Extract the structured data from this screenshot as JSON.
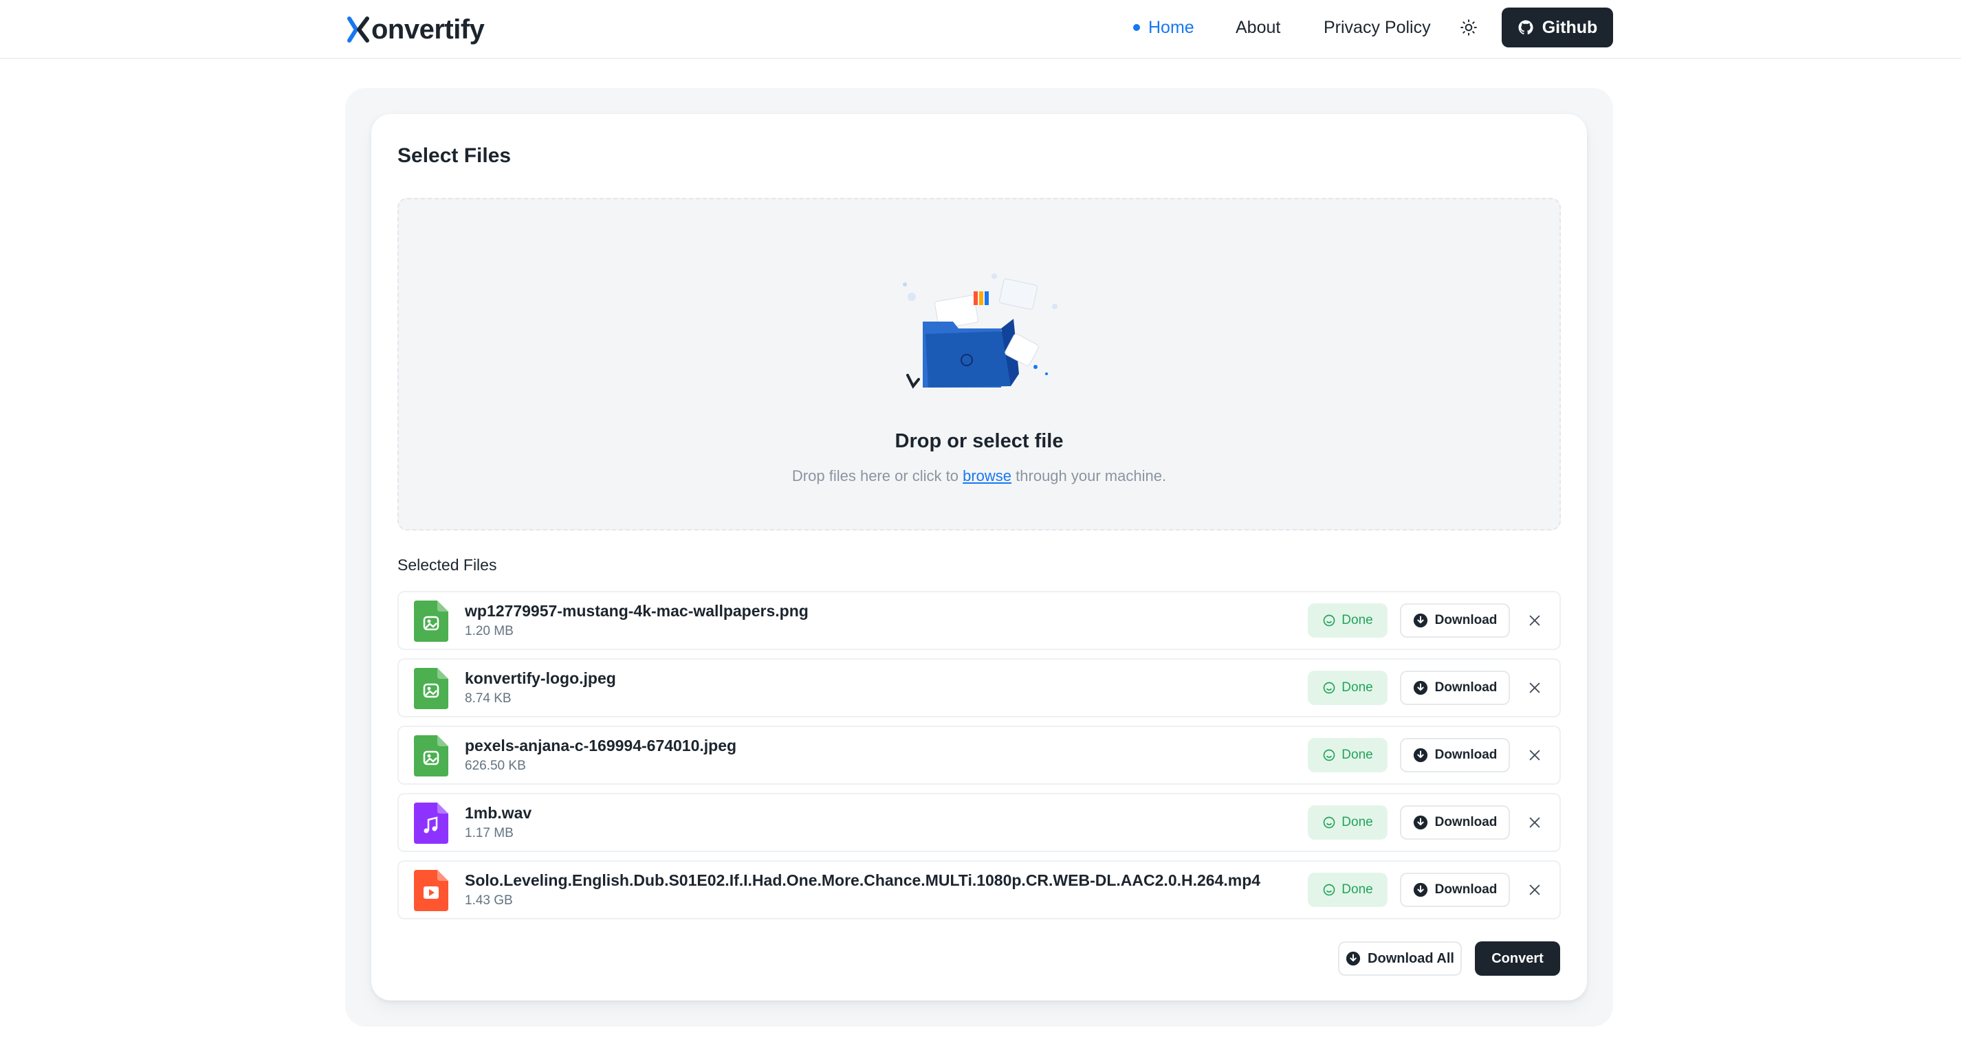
{
  "header": {
    "logo_text": "onvertify",
    "nav": {
      "home": "Home",
      "about": "About",
      "privacy": "Privacy Policy"
    },
    "theme_toggle_icon": "sun-icon",
    "github_label": "Github"
  },
  "main": {
    "title": "Select Files",
    "dropzone": {
      "title": "Drop or select file",
      "sub_before": "Drop files here or click to ",
      "sub_link": "browse",
      "sub_after": " through your machine."
    },
    "selected_title": "Selected Files",
    "files": [
      {
        "name": "wp12779957-mustang-4k-mac-wallpapers.png",
        "size": "1.20 MB",
        "type": "image",
        "status": "Done",
        "action": "Download"
      },
      {
        "name": "konvertify-logo.jpeg",
        "size": "8.74 KB",
        "type": "image",
        "status": "Done",
        "action": "Download"
      },
      {
        "name": "pexels-anjana-c-169994-674010.jpeg",
        "size": "626.50 KB",
        "type": "image",
        "status": "Done",
        "action": "Download"
      },
      {
        "name": "1mb.wav",
        "size": "1.17 MB",
        "type": "audio",
        "status": "Done",
        "action": "Download"
      },
      {
        "name": "Solo.Leveling.English.Dub.S01E02.If.I.Had.One.More.Chance.MULTi.1080p.CR.WEB-DL.AAC2.0.H.264.mp4",
        "size": "1.43 GB",
        "type": "video",
        "status": "Done",
        "action": "Download"
      }
    ],
    "download_all": "Download All",
    "convert": "Convert"
  },
  "colors": {
    "accent": "#1877f2",
    "dark": "#1c252e",
    "success": "#22a35a",
    "success_bg": "#e3f5e9",
    "image_file": "#4caf50",
    "audio_file": "#8e33ff",
    "video_file": "#ff5630"
  }
}
